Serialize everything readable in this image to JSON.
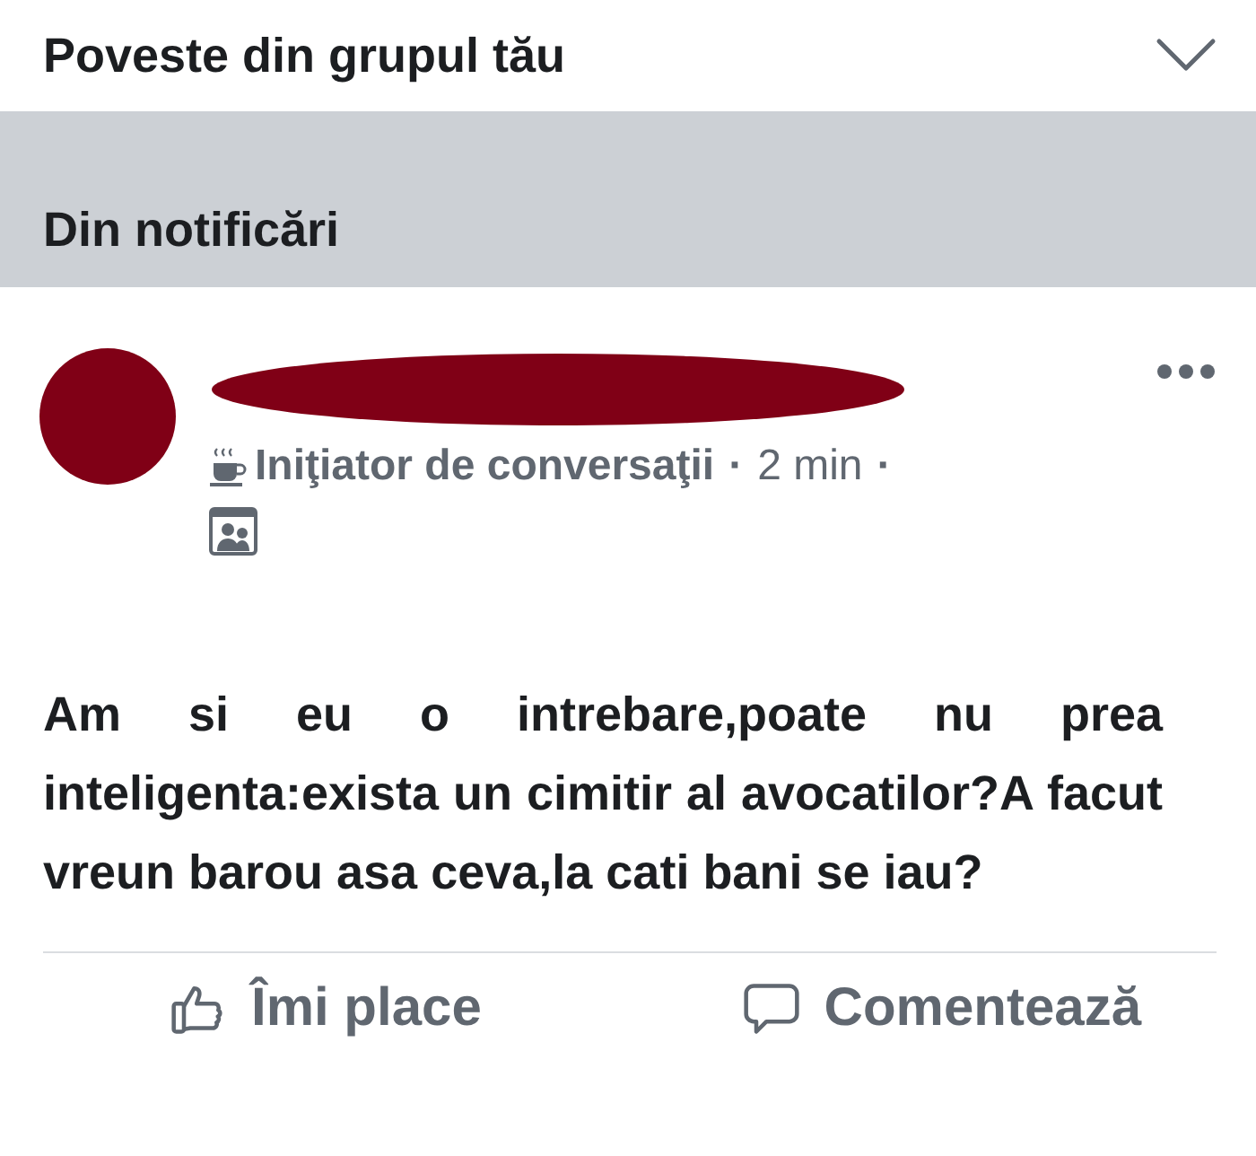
{
  "group_story": {
    "title": "Poveste din grupul tău",
    "expanded": false
  },
  "section": {
    "title": "Din notificări"
  },
  "post": {
    "author_redacted": true,
    "badge": "Iniţiator de conversaţii",
    "time": "2 min",
    "separator": "·",
    "text": "Am si eu o intrebare,poate nu prea inteligenta:exista un cimitir al avocatilor?A facut vreun barou asa ceva,la cati bani se iau?"
  },
  "actions": [
    {
      "kind": "like",
      "label": "Îmi place"
    },
    {
      "kind": "comment",
      "label": "Comentează"
    }
  ]
}
